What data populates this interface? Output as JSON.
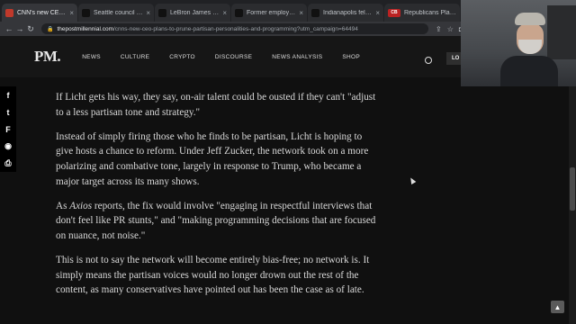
{
  "browser": {
    "tabs": [
      {
        "favicon": "",
        "title": "CNN's new CEO plans to ...",
        "active": true
      },
      {
        "favicon": "",
        "title": "Seattle council members st...",
        "active": false
      },
      {
        "favicon": "",
        "title": "LeBron James does nothin...",
        "active": false
      },
      {
        "favicon": "",
        "title": "Former employee accuses ...",
        "active": false
      },
      {
        "favicon": "",
        "title": "Indianapolis felon sentenc...",
        "active": false
      },
      {
        "favicon": "CB",
        "title": "Republicans Planning To ...",
        "active": false
      }
    ],
    "url_host": "thepostmillennial.com",
    "url_path": "/cnns-new-ceo-plans-to-prune-partisan-personalities-and-programming?utm_campaign=64494"
  },
  "site": {
    "logo": "PM.",
    "nav": [
      "NEWS",
      "CULTURE",
      "CRYPTO",
      "DISCOURSE",
      "NEWS ANALYSIS",
      "SHOP"
    ],
    "login_label": "LO"
  },
  "article": {
    "p1": "If Licht gets his way, they say, on-air talent could be ousted if they can't \"adjust to a less partisan tone and strategy.\"",
    "p2": "Instead of simply firing those who he finds to be partisan, Licht is hoping to give hosts a chance to reform. Under Jeff Zucker, the network took on a more polarizing and combative tone, largely in response to Trump, who became a major target across its many shows.",
    "p3_prefix": "As ",
    "p3_em": "Axios",
    "p3_rest": " reports, the fix would involve \"engaging in respectful interviews that don't feel like PR stunts,\" and \"making programming decisions that are focused on nuance, not noise.\"",
    "p4": "This is not to say the network will become entirely bias-free; no network is. It simply means the partisan voices would no longer drown out the rest of the content, as many conservatives have pointed out has been the case as of late."
  },
  "share": {
    "facebook": "f",
    "twitter": "t",
    "flipboard": "F",
    "other": "◉",
    "print": "⎙"
  },
  "colors": {
    "page_bg": "#101010",
    "header_bg": "#161616",
    "text": "#d8d8d8"
  }
}
